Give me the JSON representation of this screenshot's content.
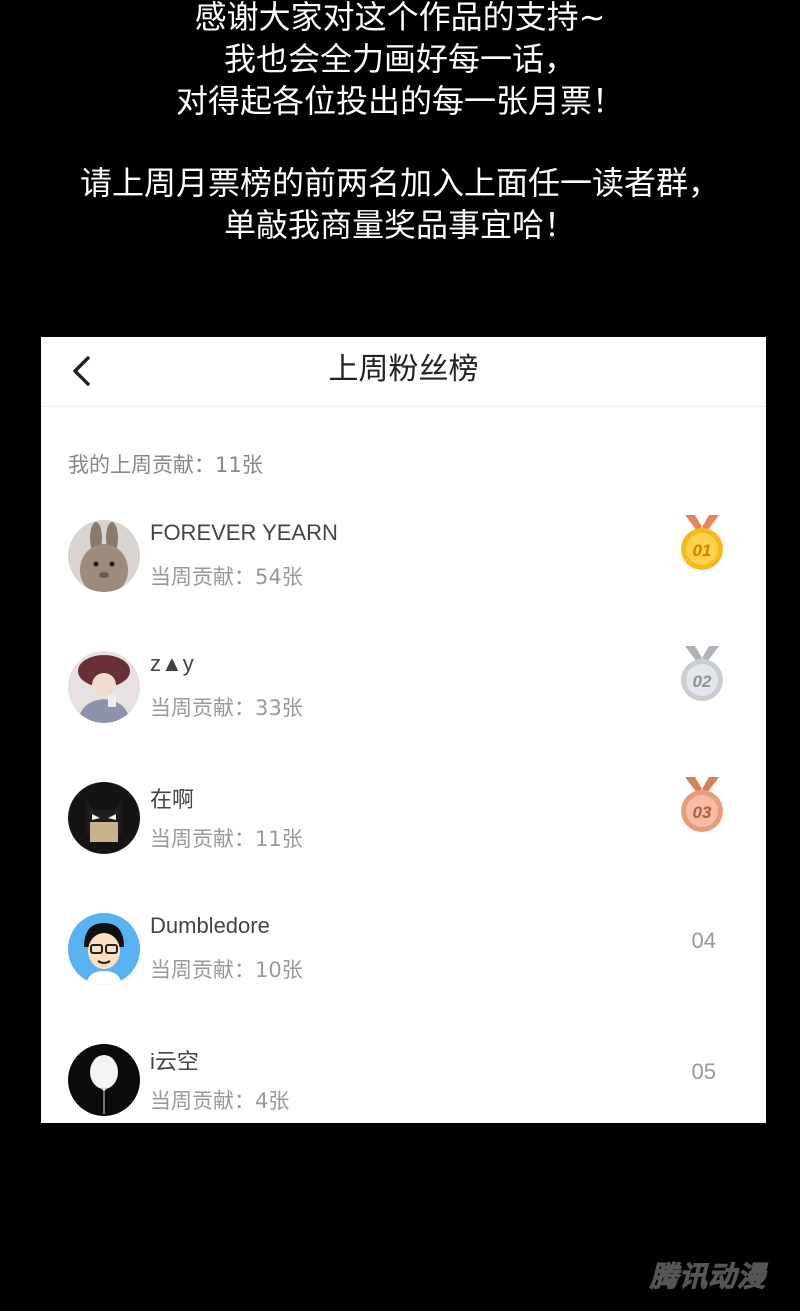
{
  "message": {
    "lines_a": [
      "感谢大家对这个作品的支持~",
      "我也会全力画好每一话，",
      "对得起各位投出的每一张月票！"
    ],
    "lines_b": [
      "请上周月票榜的前两名加入上面任一读者群，",
      "单敲我商量奖品事宜哈！"
    ]
  },
  "panel": {
    "title": "上周粉丝榜",
    "my_contribution": "我的上周贡献：11张",
    "fans": [
      {
        "name": "FOREVER YEARN",
        "contribution": "当周贡献：54张",
        "rank": "01",
        "medal": "gold"
      },
      {
        "name": "z▲y",
        "contribution": "当周贡献：33张",
        "rank": "02",
        "medal": "silver"
      },
      {
        "name": "在啊",
        "contribution": "当周贡献：11张",
        "rank": "03",
        "medal": "bronze"
      },
      {
        "name": "Dumbledore",
        "contribution": "当周贡献：10张",
        "rank": "04",
        "medal": null
      },
      {
        "name": "i云空",
        "contribution": "当周贡献：4张",
        "rank": "05",
        "medal": null
      }
    ]
  },
  "icons": {
    "back": "chevron-left-icon",
    "medal_gold": "gold-medal-icon",
    "medal_silver": "silver-medal-icon",
    "medal_bronze": "bronze-medal-icon"
  },
  "colors": {
    "gold": "#f5b91e",
    "silver": "#c9ccd0",
    "bronze": "#e89c7c"
  },
  "watermark": "腾讯动漫"
}
